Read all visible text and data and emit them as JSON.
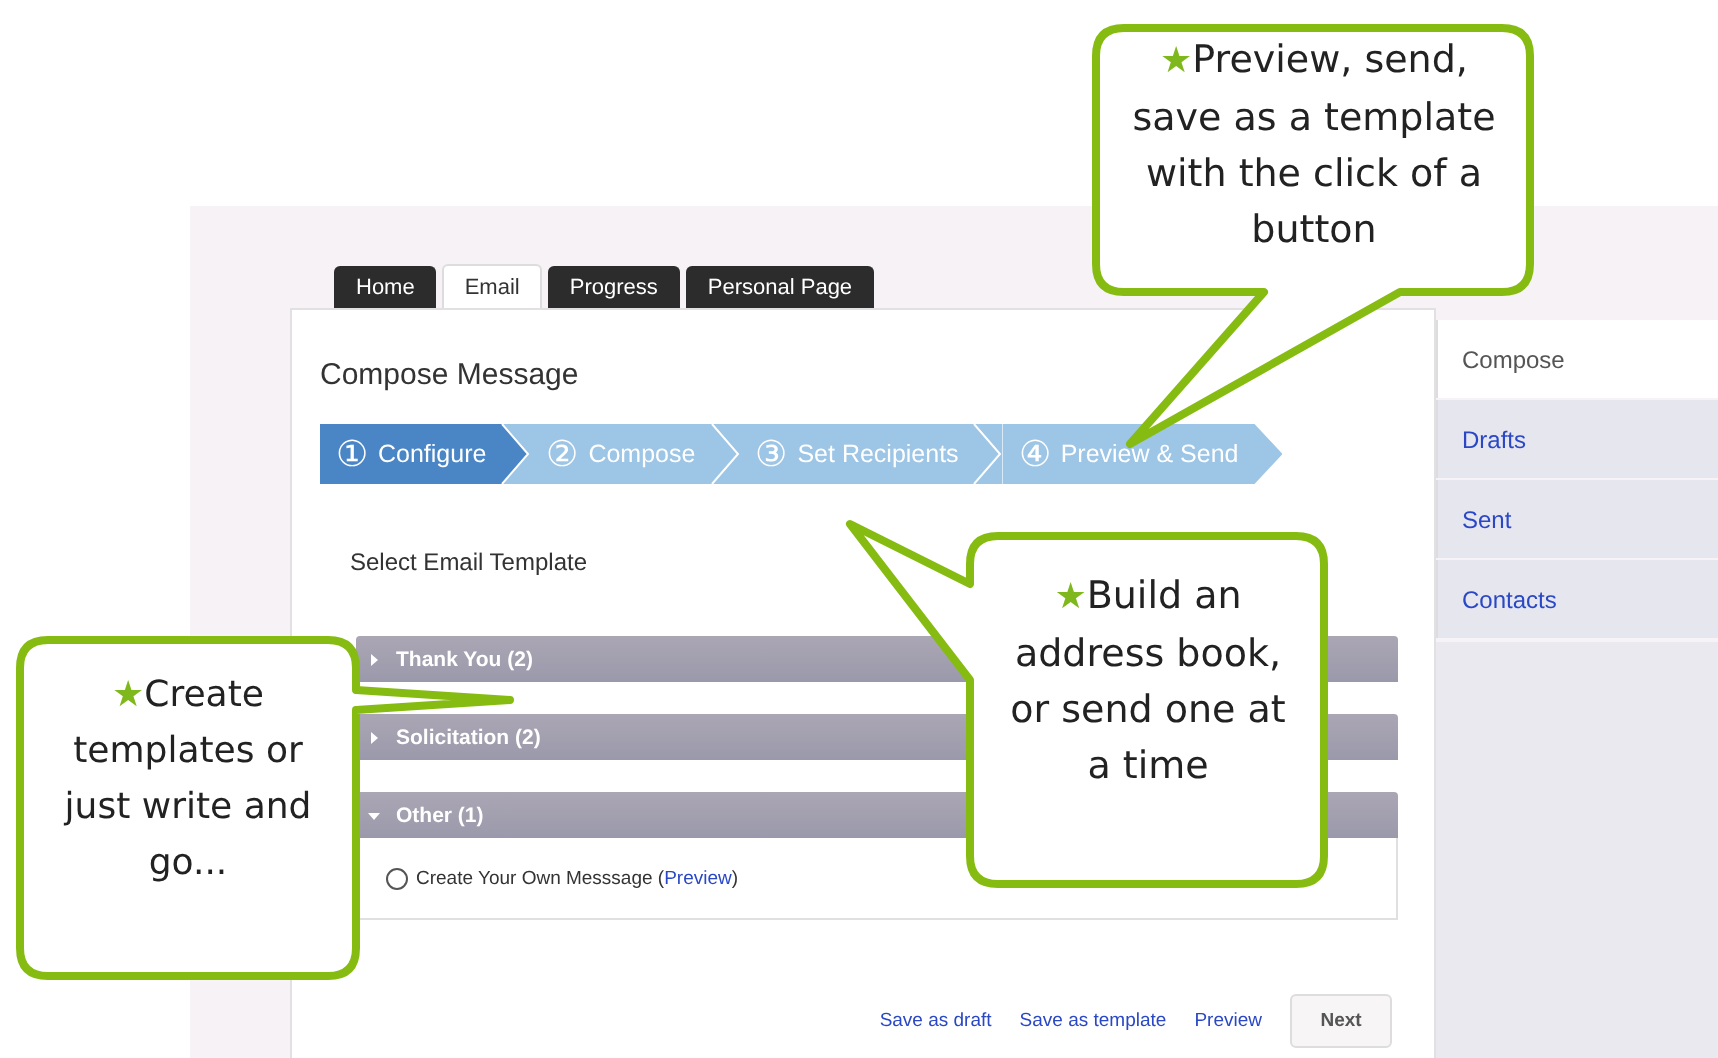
{
  "tabs": [
    {
      "label": "Home",
      "selected": false
    },
    {
      "label": "Email",
      "selected": true
    },
    {
      "label": "Progress",
      "selected": false
    },
    {
      "label": "Personal Page",
      "selected": false
    }
  ],
  "title": "Compose Message",
  "steps": [
    {
      "number": "①",
      "label": "Configure",
      "selected": true
    },
    {
      "number": "②",
      "label": "Compose",
      "selected": false
    },
    {
      "number": "③",
      "label": "Set Recipients",
      "selected": false
    },
    {
      "number": "④",
      "label": "Preview & Send",
      "selected": false
    }
  ],
  "template_heading": "Select Email Template",
  "template_groups": [
    {
      "label": "Thank You (2)",
      "expanded": false
    },
    {
      "label": "Solicitation (2)",
      "expanded": false
    },
    {
      "label": "Other (1)",
      "expanded": true,
      "options": [
        {
          "label": "Create Your Own Messsage (",
          "link": "Preview",
          "suffix": ")",
          "selected": false
        }
      ]
    }
  ],
  "actions": {
    "links": [
      "Save as draft",
      "Save as template",
      "Preview"
    ],
    "button": "Next"
  },
  "sidebar": {
    "items": [
      {
        "label": "Compose",
        "selected": true
      },
      {
        "label": "Drafts",
        "selected": false
      },
      {
        "label": "Sent",
        "selected": false
      },
      {
        "label": "Contacts",
        "selected": false
      }
    ]
  },
  "callouts": [
    {
      "mark": "★",
      "text": "Preview, send, save as a template with the click of a button"
    },
    {
      "mark": "★",
      "text": "Build an address book, or send one at a time"
    },
    {
      "mark": "★",
      "text": "Create templates or just write and go..."
    }
  ]
}
